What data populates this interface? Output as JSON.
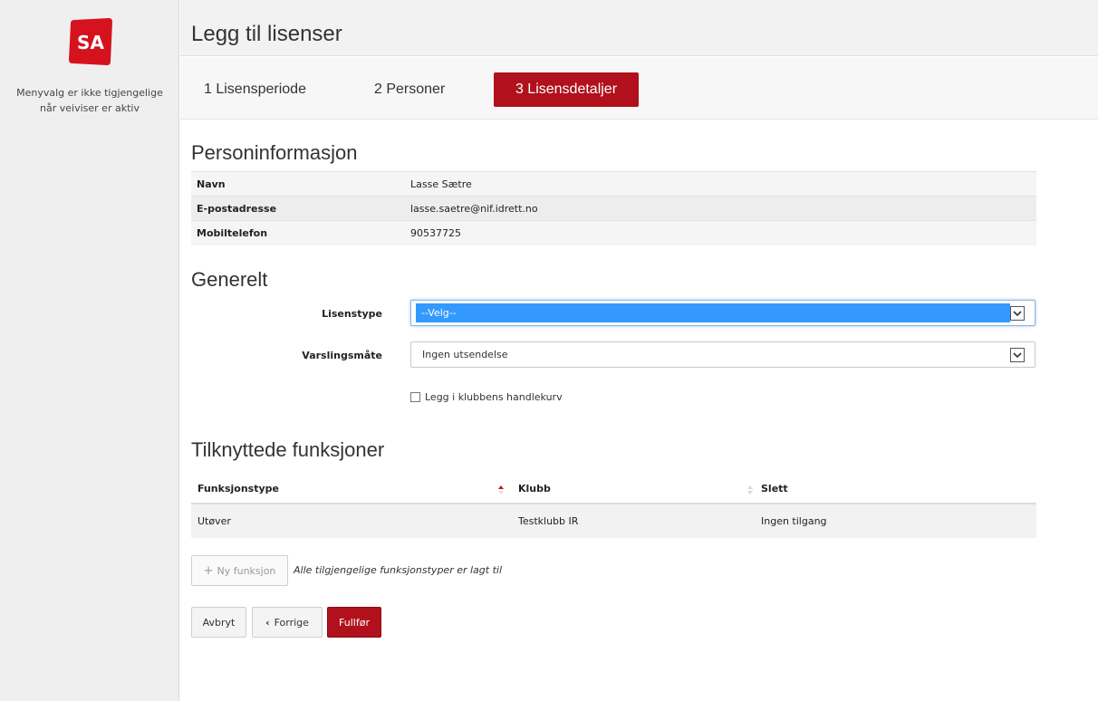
{
  "sidebar": {
    "logo_text": "SA",
    "note": "Menyvalg er ikke tigjengelige når veiviser er aktiv"
  },
  "header": {
    "title": "Legg til lisenser"
  },
  "steps": [
    {
      "label": "1 Lisensperiode"
    },
    {
      "label": "2 Personer"
    },
    {
      "label": "3 Lisensdetaljer"
    }
  ],
  "person_info": {
    "title": "Personinformasjon",
    "rows": [
      {
        "label": "Navn",
        "value": "Lasse Sætre"
      },
      {
        "label": "E-postadresse",
        "value": "lasse.saetre@nif.idrett.no"
      },
      {
        "label": "Mobiltelefon",
        "value": "90537725"
      }
    ]
  },
  "general": {
    "title": "Generelt",
    "license_type": {
      "label": "Lisenstype",
      "value": "--Velg--"
    },
    "notification": {
      "label": "Varslingsmåte",
      "value": "Ingen utsendelse"
    },
    "cart_checkbox": {
      "label": "Legg i klubbens handlekurv",
      "checked": false
    }
  },
  "functions": {
    "title": "Tilknyttede funksjoner",
    "columns": [
      "Funksjonstype",
      "Klubb",
      "Slett"
    ],
    "rows": [
      [
        "Utøver",
        "Testklubb IR",
        "Ingen tilgang"
      ]
    ],
    "new_button": "Ny funksjon",
    "note": "Alle tilgjengelige funksjonstyper er lagt til"
  },
  "actions": {
    "cancel": "Avbryt",
    "previous": "Forrige",
    "finish": "Fullfør"
  },
  "colors": {
    "accent": "#b0111c",
    "selection": "#3399ff"
  }
}
